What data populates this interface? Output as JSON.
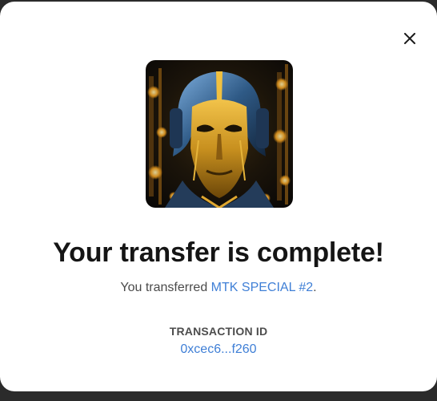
{
  "modal": {
    "close_icon": "close-icon",
    "image_alt": "MTK SPECIAL #2 artwork",
    "title": "Your transfer is complete!",
    "subtitle_prefix": "You transferred ",
    "item_name": "MTK SPECIAL #2",
    "subtitle_suffix": ".",
    "transaction_label": "TRANSACTION ID",
    "transaction_id": "0xcec6...f260"
  },
  "colors": {
    "link": "#3f7fd6",
    "title": "#151515",
    "backdrop": "#2b2b2b"
  }
}
